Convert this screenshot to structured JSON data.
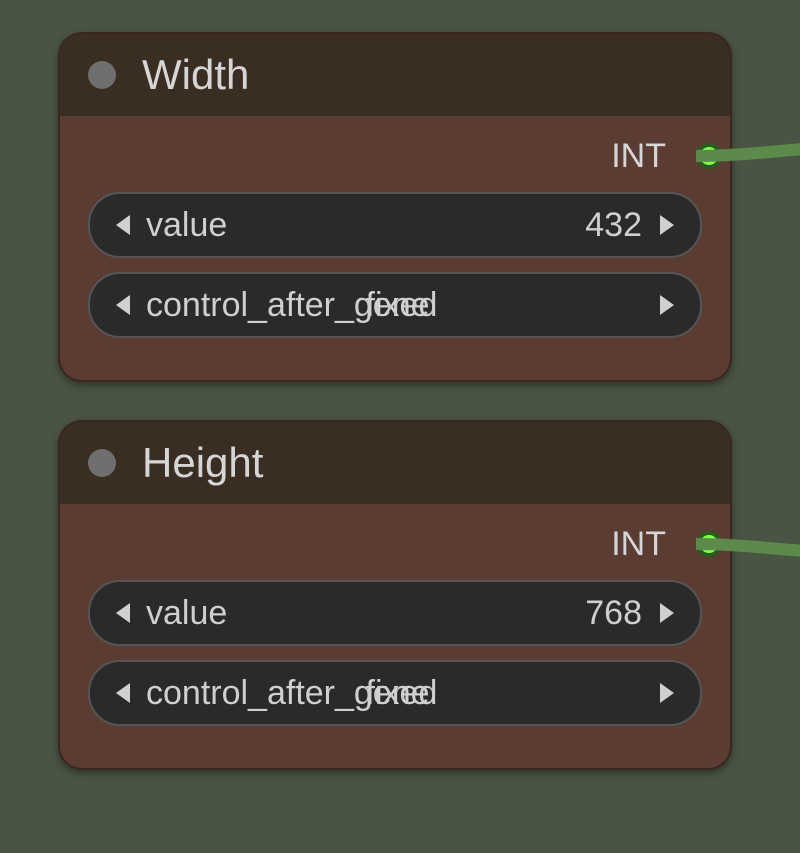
{
  "nodes": [
    {
      "title": "Width",
      "output_label": "INT",
      "fields": {
        "value": {
          "label": "value",
          "value": "432"
        },
        "control": {
          "label": "control_after_gene",
          "value": "fixed"
        }
      }
    },
    {
      "title": "Height",
      "output_label": "INT",
      "fields": {
        "value": {
          "label": "value",
          "value": "768"
        },
        "control": {
          "label": "control_after_gene",
          "value": "fixed"
        }
      }
    }
  ]
}
